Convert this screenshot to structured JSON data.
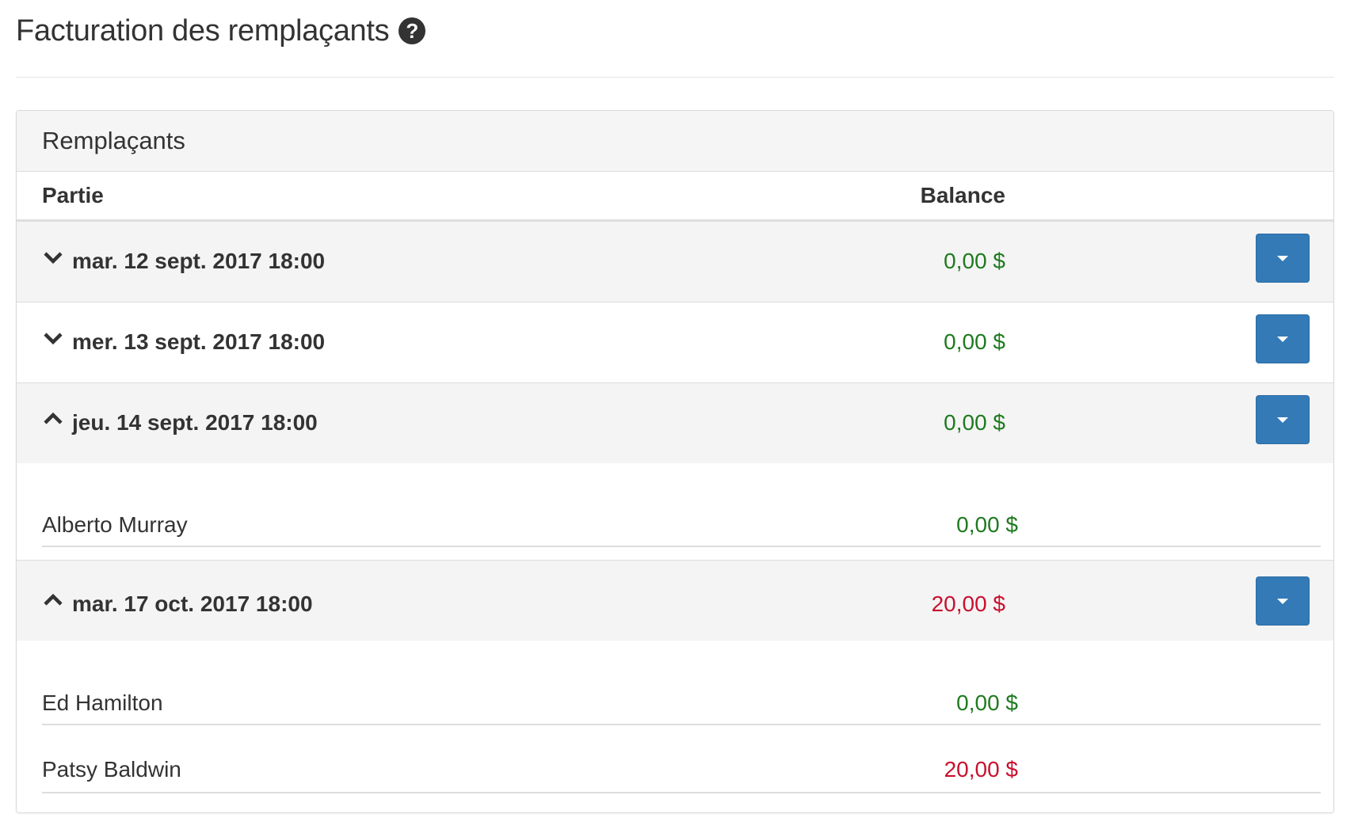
{
  "page": {
    "title": "Facturation des remplaçants",
    "help_icon": "question-circle-icon"
  },
  "panel": {
    "title": "Remplaçants",
    "columns": {
      "partie": "Partie",
      "balance": "Balance"
    }
  },
  "games": [
    {
      "label": "mar. 12 sept. 2017 18:00",
      "balance": "0,00 $",
      "status": "green",
      "expanded": false,
      "players": []
    },
    {
      "label": "mer. 13 sept. 2017 18:00",
      "balance": "0,00 $",
      "status": "green",
      "expanded": false,
      "players": []
    },
    {
      "label": "jeu. 14 sept. 2017 18:00",
      "balance": "0,00 $",
      "status": "green",
      "expanded": true,
      "players": [
        {
          "name": "Alberto Murray",
          "balance": "0,00 $",
          "status": "green"
        }
      ]
    },
    {
      "label": "mar. 17 oct. 2017 18:00",
      "balance": "20,00 $",
      "status": "red",
      "expanded": true,
      "players": [
        {
          "name": "Ed Hamilton",
          "balance": "0,00 $",
          "status": "green"
        },
        {
          "name": "Patsy Baldwin",
          "balance": "20,00 $",
          "status": "red"
        }
      ]
    }
  ],
  "colors": {
    "positive": "#1f7a1f",
    "negative": "#c8102e",
    "button": "#337ab7"
  }
}
